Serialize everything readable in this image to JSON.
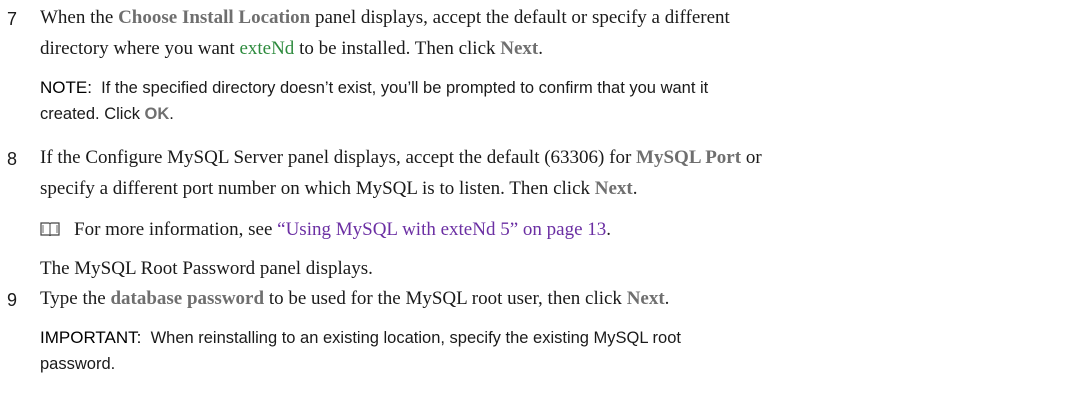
{
  "steps": [
    {
      "number": "7",
      "line1": {
        "a": "When the ",
        "ui": "Choose Install Location",
        "b": " panel displays, accept the default or specify a different"
      },
      "line2": {
        "a": "directory where you want ",
        "product": "exteNd",
        "b": " to be installed. Then click ",
        "ui": "Next",
        "c": "."
      },
      "note": {
        "label": "NOTE:",
        "line1": "If the specified directory doesn’t exist, you’ll be prompted to confirm that you want it",
        "line2a": "created. Click ",
        "ui": "OK",
        "line2b": "."
      }
    },
    {
      "number": "8",
      "line1": {
        "a": "If the Configure MySQL Server panel displays, accept the default (63306) for ",
        "ui": "MySQL Port",
        "b": " or"
      },
      "line2": "specify a different port number on which MySQL is to listen. Then click ",
      "line2_ui": "Next",
      "line2_end": ".",
      "info": {
        "icon": "book-icon",
        "text": "For more information, see ",
        "link": "“Using MySQL with exteNd 5” on page 13",
        "end": "."
      },
      "result": "The MySQL Root Password panel displays."
    },
    {
      "number": "9",
      "line1": {
        "a": "Type the ",
        "ui": "database password",
        "b": " to be used for the MySQL root user, then click ",
        "ui2": "Next",
        "c": "."
      },
      "important": {
        "label": "IMPORTANT:",
        "line1": "When reinstalling to an existing location, specify the existing MySQL root",
        "line2": "password."
      }
    }
  ]
}
